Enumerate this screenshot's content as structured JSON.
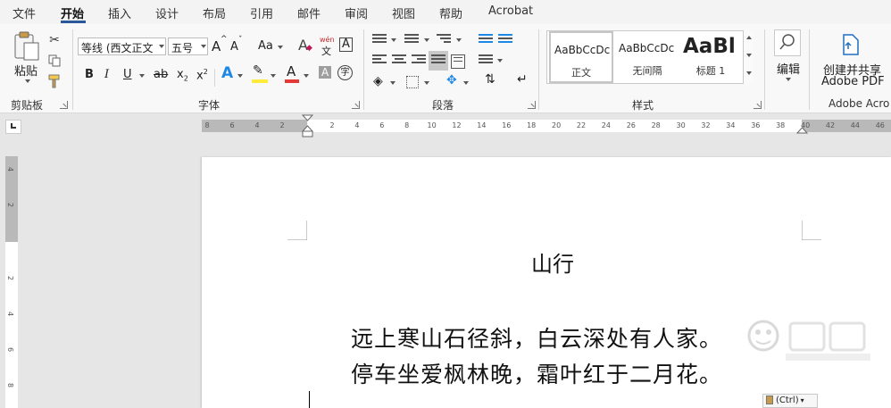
{
  "menu": {
    "items": [
      "文件",
      "开始",
      "插入",
      "设计",
      "布局",
      "引用",
      "邮件",
      "审阅",
      "视图",
      "帮助",
      "Acrobat"
    ],
    "active": "开始"
  },
  "ribbon": {
    "clipboard": {
      "paste_label": "粘贴",
      "group_label": "剪贴板"
    },
    "font": {
      "font_name": "等线 (西文正文",
      "font_size": "五号",
      "grow_label": "A",
      "shrink_label": "A",
      "case_label": "Aa",
      "phonetic_top": "wén",
      "phonetic_bottom": "文",
      "border_char_label": "A",
      "bold": "B",
      "italic": "I",
      "underline": "U",
      "strike": "ab",
      "subscript": "x",
      "superscript": "x",
      "text_effect": "A",
      "highlight": "A",
      "font_color": "A",
      "char_shade": "A",
      "enclose": "字",
      "group_label": "字体"
    },
    "paragraph": {
      "group_label": "段落"
    },
    "styles": {
      "tiles": [
        {
          "sample": "AaBbCcDc",
          "name": "正文"
        },
        {
          "sample": "AaBbCcDc",
          "name": "无间隔"
        },
        {
          "sample": "AaBl",
          "name": "标题 1"
        }
      ],
      "group_label": "样式"
    },
    "editing": {
      "label": "编辑"
    },
    "adobe": {
      "create_line1": "创建并共享",
      "create_line2": "Adobe PDF",
      "group_label": "Adobe Acro"
    }
  },
  "ruler": {
    "left_numbers": [
      "8",
      "6",
      "4",
      "2"
    ],
    "right_numbers": [
      "2",
      "4",
      "6",
      "8",
      "10",
      "12",
      "14",
      "16",
      "18",
      "20",
      "22",
      "24",
      "26",
      "28",
      "30",
      "32",
      "34",
      "36",
      "38",
      "40",
      "42",
      "44",
      "46"
    ],
    "vertical_numbers": [
      "4",
      "2",
      "2",
      "4",
      "6",
      "8"
    ]
  },
  "document": {
    "title": "山行",
    "lines": [
      "远上寒山石径斜，白云深处有人家。",
      "停车坐爱枫林晚，霜叶红于二月花。"
    ],
    "paste_options": "(Ctrl)"
  },
  "colors": {
    "accent": "#2b579a",
    "highlight": "#ffeb3b",
    "font_color": "#e53935"
  }
}
